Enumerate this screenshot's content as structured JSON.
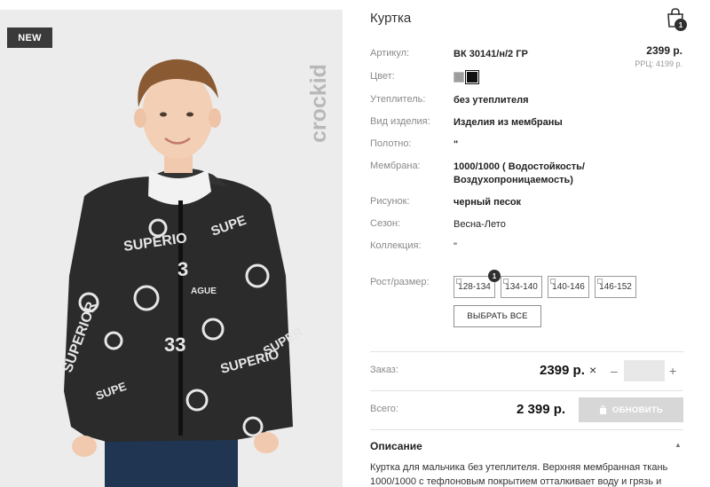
{
  "product": {
    "badge": "NEW",
    "brand": "crockid",
    "title": "Куртка",
    "price": "2399 р.",
    "rrc": "РРЦ: 4199 р."
  },
  "cart": {
    "count": "1",
    "icon": "shopping-bag-icon"
  },
  "attributes": [
    {
      "label": "Артикул:",
      "value": "ВК 30141/н/2 ГР"
    },
    {
      "label": "Цвет:",
      "value": ""
    },
    {
      "label": "Утеплитель:",
      "value": "без утеплителя"
    },
    {
      "label": "Вид изделия:",
      "value": "Изделия из мембраны"
    },
    {
      "label": "Полотно:",
      "value": "\""
    },
    {
      "label": "Мембрана:",
      "value": "1000/1000 ( Водостойкость/ Воздухопроницаемость)"
    },
    {
      "label": "Рисунок:",
      "value": "черный песок"
    },
    {
      "label": "Сезон:",
      "value": "Весна-Лето"
    },
    {
      "label": "Коллекция:",
      "value": "\""
    }
  ],
  "colors": [
    {
      "name": "gray",
      "hex": "#9d9d9d"
    },
    {
      "name": "black",
      "hex": "#111111",
      "selected": true
    }
  ],
  "sizes": {
    "label": "Рост/размер:",
    "options": [
      "128-134",
      "134-140",
      "140-146",
      "146-152"
    ],
    "selected_count": "1",
    "select_all": "ВЫБРАТЬ ВСЕ"
  },
  "order": {
    "label": "Заказ:",
    "price": "2399 р.",
    "times": "×",
    "minus": "–",
    "plus": "+",
    "quantity": ""
  },
  "total": {
    "label": "Всего:",
    "price": "2 399 р.",
    "update_button": "ОБНОВИТЬ"
  },
  "description": {
    "title": "Описание",
    "caret": "▲",
    "text": "Куртка для мальчика без утеплителя. Верхняя мембранная ткань 1000/1000 с тефлоновым покрытием отталкивает воду и грязь и"
  }
}
